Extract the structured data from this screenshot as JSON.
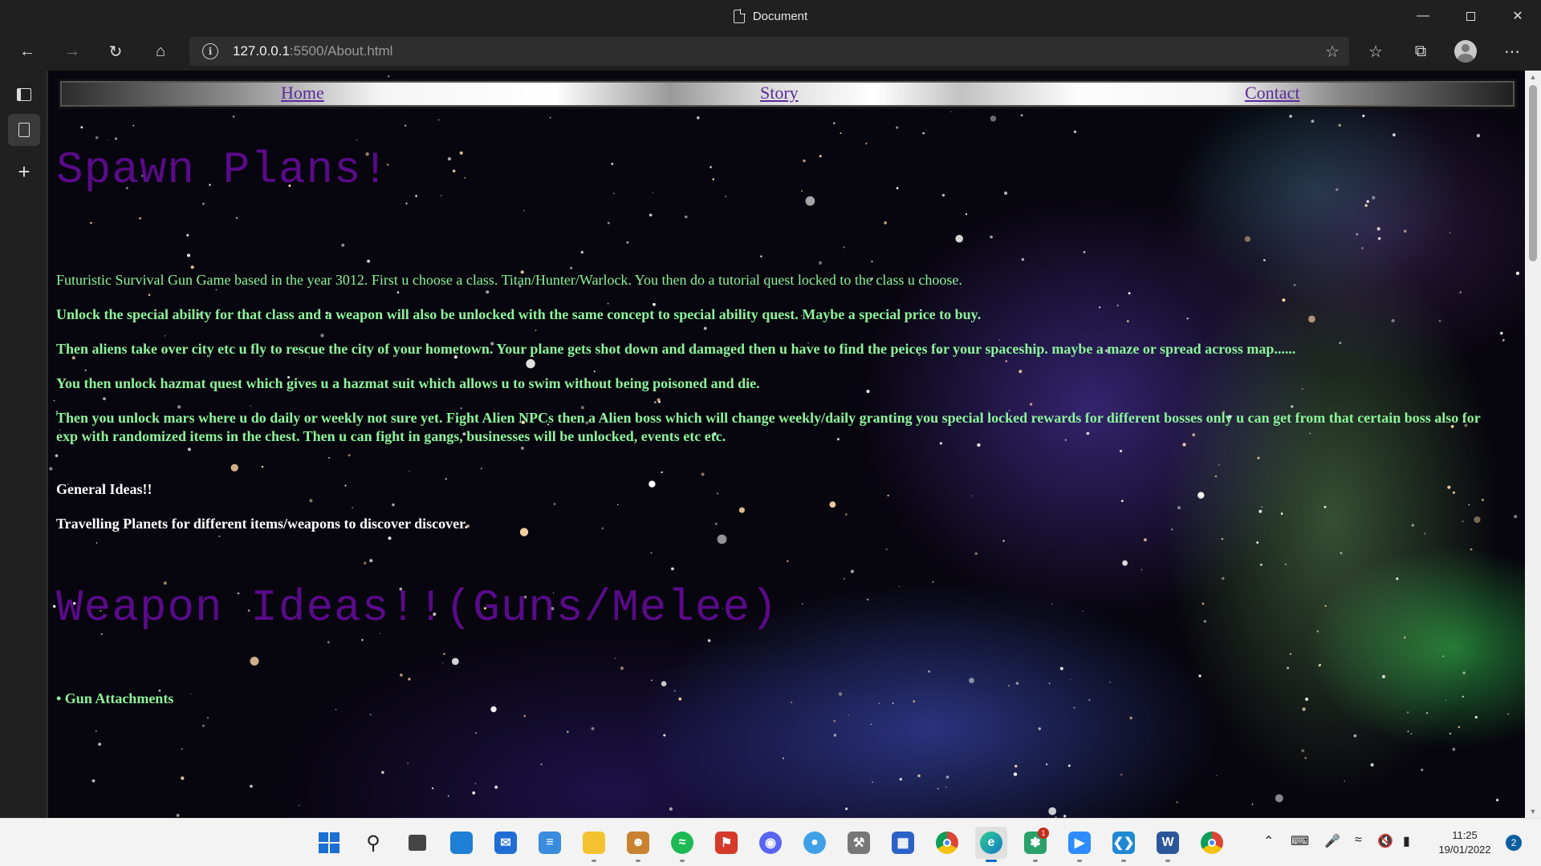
{
  "window": {
    "title": "Document"
  },
  "address": {
    "host": "127.0.0.1",
    "rest": ":5500/About.html"
  },
  "sitenav": {
    "home": "Home",
    "story": "Story",
    "contact": "Contact"
  },
  "content": {
    "heading1": "Spawn Plans!",
    "intro": "Futuristic Survival Gun Game based in the year 3012. First u choose a class. Titan/Hunter/Warlock. You then do a tutorial quest locked to the class u choose.",
    "p1": "Unlock the special ability for that class and a weapon will also be unlocked with the same concept to special ability quest. Maybe a special price to buy.",
    "p2": "Then aliens take over city etc u fly to rescue the city of your hometown. Your plane gets shot down and damaged then u have to find the peices for your spaceship. maybe a maze or spread across map......",
    "p3": "You then unlock hazmat quest which gives u a hazmat suit which allows u to swim without being poisoned and die.",
    "p4": "Then you unlock mars where u do daily or weekly not sure yet. Fight Alien NPCs then a Alien boss which will change weekly/daily granting you special locked rewards for different bosses only u can get from that certain boss also for exp with randomized items in the chest. Then u can fight in gangs, businesses will be unlocked, events etc etc.",
    "general_heading": "General Ideas!!",
    "general_p": "Travelling Planets for different items/weapons to discover discover.",
    "heading2": "Weapon Ideas!!(Guns/Melee)",
    "bullet1": "• Gun Attachments"
  },
  "taskbar": {
    "time": "11:25",
    "date": "19/01/2022",
    "notifications": "2",
    "store_badge": "1"
  },
  "colors": {
    "heading": "#5a0a8a",
    "green_text": "#8cf59a",
    "nav_link": "#5a2a9a"
  }
}
